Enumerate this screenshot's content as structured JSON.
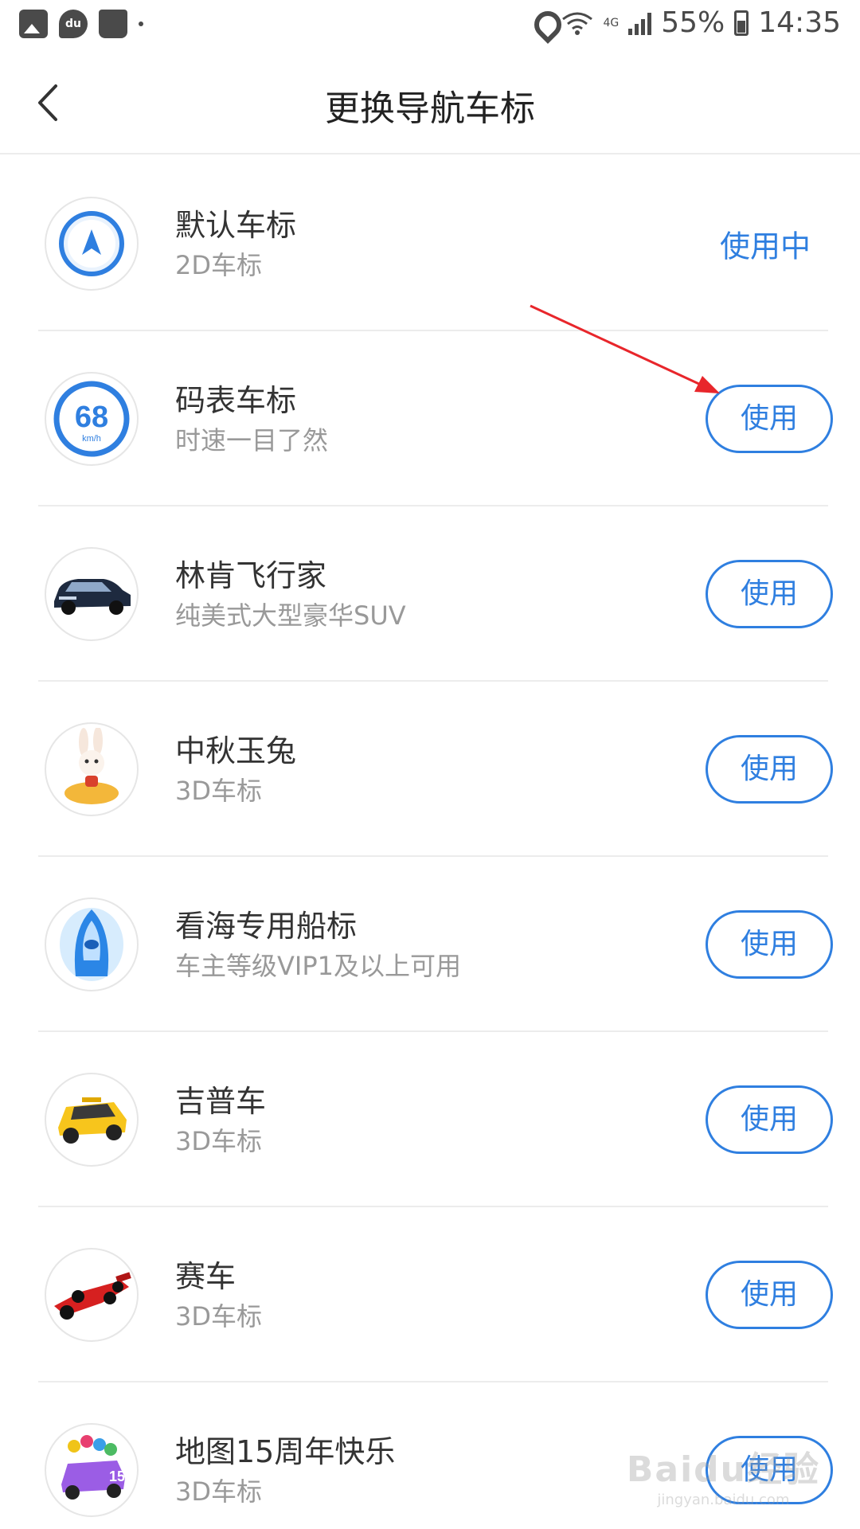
{
  "status_bar": {
    "du_label": "du",
    "battery": "55%",
    "time": "14:35",
    "network": "4G"
  },
  "header": {
    "title": "更换导航车标"
  },
  "items": [
    {
      "title": "默认车标",
      "subtitle": "2D车标",
      "action": "使用中",
      "icon": "navigation-arrow-icon"
    },
    {
      "title": "码表车标",
      "subtitle": "时速一目了然",
      "action": "使用",
      "icon": "speedometer-icon",
      "speed": "68",
      "unit": "km/h"
    },
    {
      "title": "林肯飞行家",
      "subtitle": "纯美式大型豪华SUV",
      "action": "使用",
      "icon": "suv-car-icon"
    },
    {
      "title": "中秋玉兔",
      "subtitle": "3D车标",
      "action": "使用",
      "icon": "rabbit-icon"
    },
    {
      "title": "看海专用船标",
      "subtitle": "车主等级VIP1及以上可用",
      "action": "使用",
      "icon": "boat-icon"
    },
    {
      "title": "吉普车",
      "subtitle": "3D车标",
      "action": "使用",
      "icon": "jeep-icon"
    },
    {
      "title": "赛车",
      "subtitle": "3D车标",
      "action": "使用",
      "icon": "race-car-icon"
    },
    {
      "title": "地图15周年快乐",
      "subtitle": "3D车标",
      "action": "使用",
      "icon": "anniversary-car-icon",
      "badge": "15"
    }
  ],
  "watermark": {
    "logo": "Baidu经验",
    "url": "jingyan.baidu.com"
  },
  "colors": {
    "accent": "#2f7fe0",
    "annotation": "#e8262b"
  }
}
